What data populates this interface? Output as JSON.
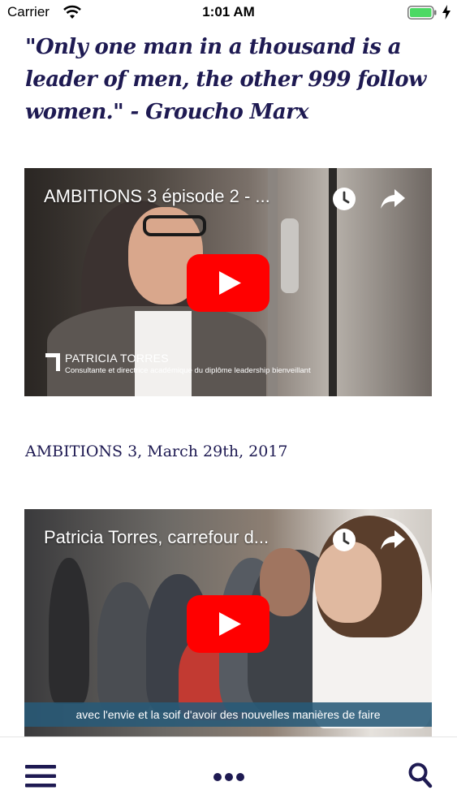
{
  "status_bar": {
    "carrier": "Carrier",
    "time": "1:01 AM"
  },
  "quote": "\"Only one man in a thousand is a leader of men, the other 999 follow women.\" - Groucho Marx",
  "videos": [
    {
      "title": "AMBITIONS 3 épisode 2 - ...",
      "lower_third_name": "PATRICIA TORRES",
      "lower_third_subtitle": "Consultante et directrice académique du diplôme leadership bienveillant"
    },
    {
      "title": "Patricia Torres, carrefour d...",
      "subtitle": "avec l'envie et la soif d'avoir des nouvelles manières de faire"
    }
  ],
  "caption": "AMBITIONS 3, March 29th, 2017",
  "icons": {
    "wifi": "wifi-icon",
    "battery": "battery-icon",
    "charging": "charging-icon",
    "watch_later": "clock-icon",
    "share": "share-icon",
    "play": "youtube-play-icon",
    "menu": "hamburger-menu-icon",
    "more": "more-dots-icon",
    "search": "search-icon"
  },
  "colors": {
    "text": "#1e1a52",
    "battery": "#4cd964",
    "youtube_red": "#ff0000",
    "icon": "#1e1a52"
  }
}
